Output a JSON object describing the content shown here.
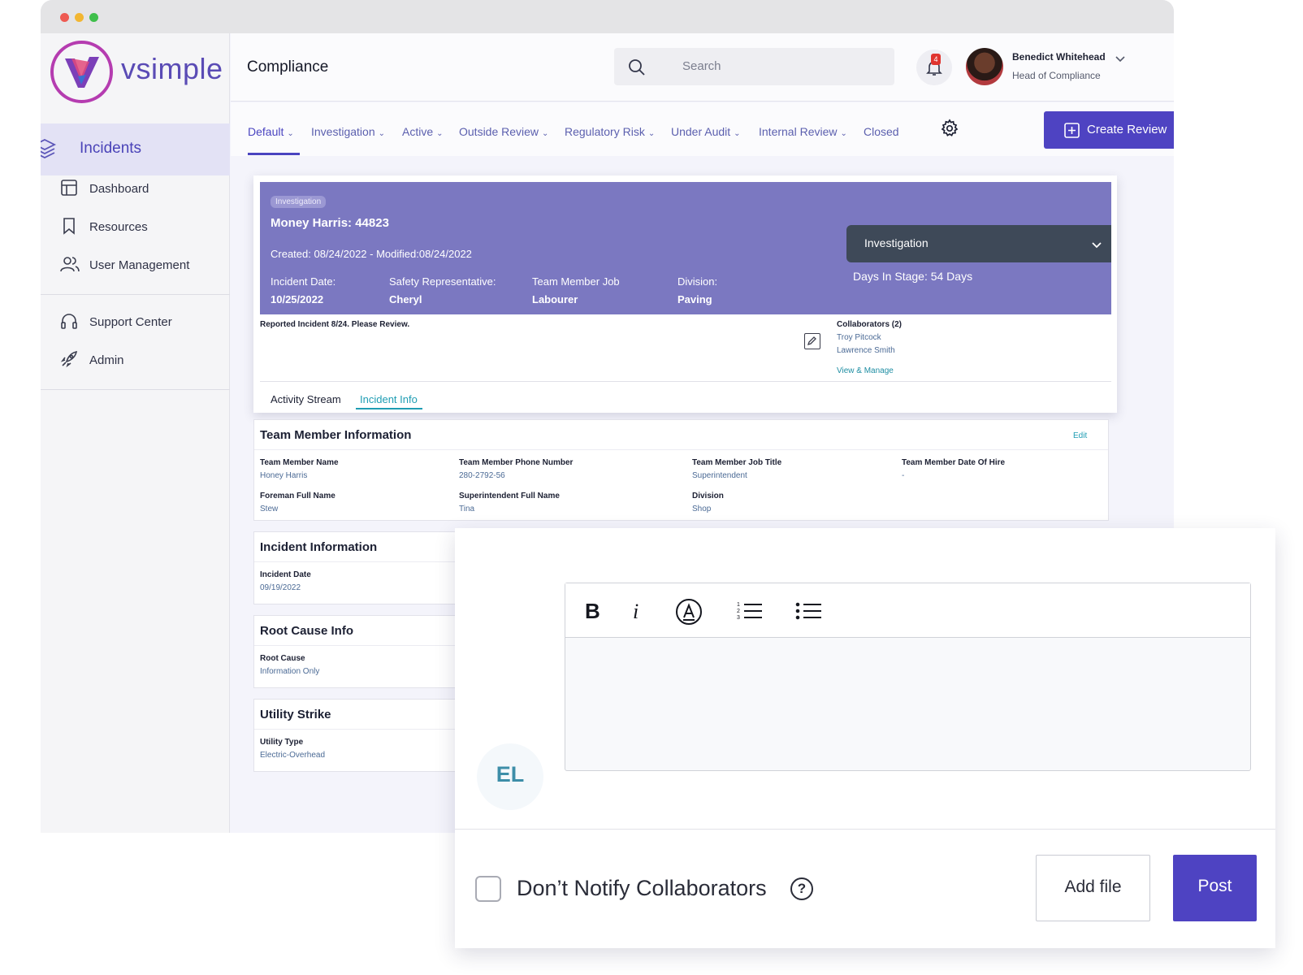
{
  "app": {
    "logo_text": "vsimple",
    "page_title": "Compliance"
  },
  "sidebar": {
    "active_item": "Incidents",
    "items": [
      {
        "label": "Dashboard",
        "icon": "dashboard-icon"
      },
      {
        "label": "Resources",
        "icon": "bookmark-icon"
      },
      {
        "label": "User Management",
        "icon": "users-icon"
      },
      {
        "label": "Support Center",
        "icon": "headset-icon"
      },
      {
        "label": "Admin",
        "icon": "rocket-icon"
      }
    ]
  },
  "header": {
    "search_placeholder": "Search",
    "notification_count": "4",
    "user_name": "Benedict Whitehead",
    "user_role": "Head of Compliance"
  },
  "stage_tabs": [
    "Default",
    "Investigation",
    "Active",
    "Outside Review",
    "Regulatory Risk",
    "Under Audit",
    "Internal Review",
    "Closed"
  ],
  "create_button": "Create Review",
  "case": {
    "badge": "Investigation",
    "title": "Money Harris: 44823",
    "dates": "Created: 08/24/2022 - Modified:08/24/2022",
    "fields": [
      {
        "label": "Incident Date:",
        "value": "10/25/2022"
      },
      {
        "label": "Safety Representative:",
        "value": "Cheryl"
      },
      {
        "label": "Team Member Job",
        "value": "Labourer"
      },
      {
        "label": "Division:",
        "value": "Paving"
      }
    ],
    "stage": "Investigation",
    "days_in_stage": "Days In Stage: 54 Days",
    "note": "Reported Incident 8/24. Please Review.",
    "collaborators_title": "Collaborators (2)",
    "collaborators": [
      "Troy Pitcock",
      "Lawrence Smith"
    ],
    "view_manage": "View & Manage",
    "tabs": [
      "Activity Stream",
      "Incident Info"
    ]
  },
  "team_member": {
    "title": "Team Member Information",
    "edit": "Edit",
    "fields": [
      {
        "label": "Team Member Name",
        "value": "Honey Harris"
      },
      {
        "label": "Team Member Phone Number",
        "value": "280-2792-56"
      },
      {
        "label": "Team Member Job Title",
        "value": "Superintendent"
      },
      {
        "label": "Team Member Date Of Hire",
        "value": "-"
      },
      {
        "label": "Foreman Full Name",
        "value": "Stew"
      },
      {
        "label": "Superintendent Full Name",
        "value": "Tina"
      },
      {
        "label": "Division",
        "value": "Shop"
      }
    ]
  },
  "incident_info": {
    "title": "Incident Information",
    "label": "Incident Date",
    "value": "09/19/2022"
  },
  "root_cause": {
    "title": "Root Cause Info",
    "label": "Root Cause",
    "value": "Information Only"
  },
  "utility": {
    "title": "Utility Strike",
    "label": "Utility Type",
    "value": "Electric-Overhead"
  },
  "composer": {
    "avatar_initials": "EL",
    "notify_label": "Don’t Notify Collaborators",
    "add_file": "Add file",
    "post": "Post"
  },
  "colors": {
    "accent": "#4e43c2",
    "banner": "#7b78c1",
    "link": "#1f9db3"
  }
}
